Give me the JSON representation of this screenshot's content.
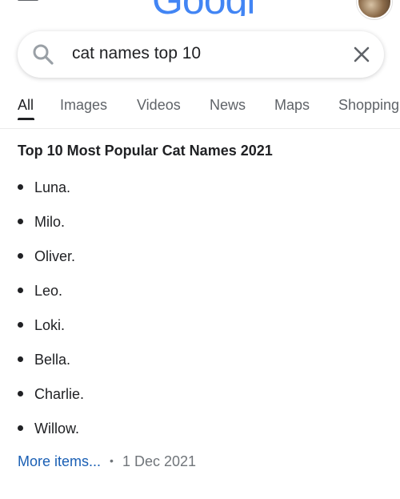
{
  "header": {
    "logo_text": "Google"
  },
  "search": {
    "query": "cat names top 10"
  },
  "tabs": [
    {
      "label": "All",
      "active": true
    },
    {
      "label": "Images",
      "active": false
    },
    {
      "label": "Videos",
      "active": false
    },
    {
      "label": "News",
      "active": false
    },
    {
      "label": "Maps",
      "active": false
    },
    {
      "label": "Shopping",
      "active": false
    }
  ],
  "snippet": {
    "title": "Top 10 Most Popular Cat Names 2021",
    "items": [
      "Luna.",
      "Milo.",
      "Oliver.",
      "Leo.",
      "Loki.",
      "Bella.",
      "Charlie.",
      "Willow."
    ],
    "more_label": "More items...",
    "separator": "•",
    "date": "1 Dec 2021"
  },
  "colors": {
    "link": "#1a5fb4",
    "text": "#202124",
    "muted": "#5f6368",
    "logo_blue": "#4285f4"
  }
}
